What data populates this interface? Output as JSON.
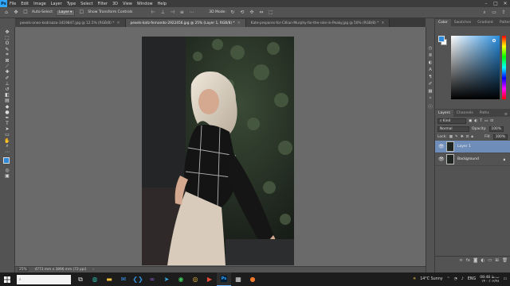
{
  "app": {
    "logo_text": "Ps"
  },
  "menu": [
    "File",
    "Edit",
    "Image",
    "Layer",
    "Type",
    "Select",
    "Filter",
    "3D",
    "View",
    "Window",
    "Help"
  ],
  "window_controls": {
    "minimize": "–",
    "maximize": "□",
    "close": "✕"
  },
  "options_bar": {
    "auto_select_label": "Auto-Select",
    "layer_select_value": "Layer",
    "show_transform_label": "Show Transform Controls",
    "mode_3d_label": "3D Mode:"
  },
  "tabs": [
    {
      "label": "pexels-oneo-kodraaza-3419847.jpg @ 12.5% (RGB/8) *",
      "active": false
    },
    {
      "label": "pexels-katz-fernando-2922456.jpg @ 25% (Layer 1, RGB/8) *",
      "active": true
    },
    {
      "label": "Kate-prepares-for-Cillian-Murphy-for-the-role-in-Peaky.jpg @ 50% (RGB/8) *",
      "active": false
    }
  ],
  "status_bar": {
    "zoom": "25%",
    "doc_info": "4773 mm x 3896 mm (72 ppi)"
  },
  "color_panel": {
    "tabs": [
      "Color",
      "Swatches",
      "Gradient",
      "Patterns"
    ],
    "foreground_color": "#2d8ad8",
    "background_color": "#ffffff"
  },
  "layers_panel": {
    "tabs": [
      "Layers",
      "Channels",
      "Paths"
    ],
    "filter_kind": "Kind",
    "blend_mode": "Normal",
    "opacity_label": "Opacity:",
    "opacity_value": "100%",
    "lock_label": "Lock:",
    "fill_label": "Fill:",
    "fill_value": "100%",
    "layers": [
      {
        "name": "Layer 1",
        "selected": true
      },
      {
        "name": "Background",
        "selected": false
      }
    ]
  },
  "taskbar": {
    "search_placeholder": "",
    "weather": "14°C  Sunny",
    "language": "ENG",
    "time": "08:48 ب.ظ",
    "date": "۱۴۰۰/۰۶/۲۸"
  }
}
